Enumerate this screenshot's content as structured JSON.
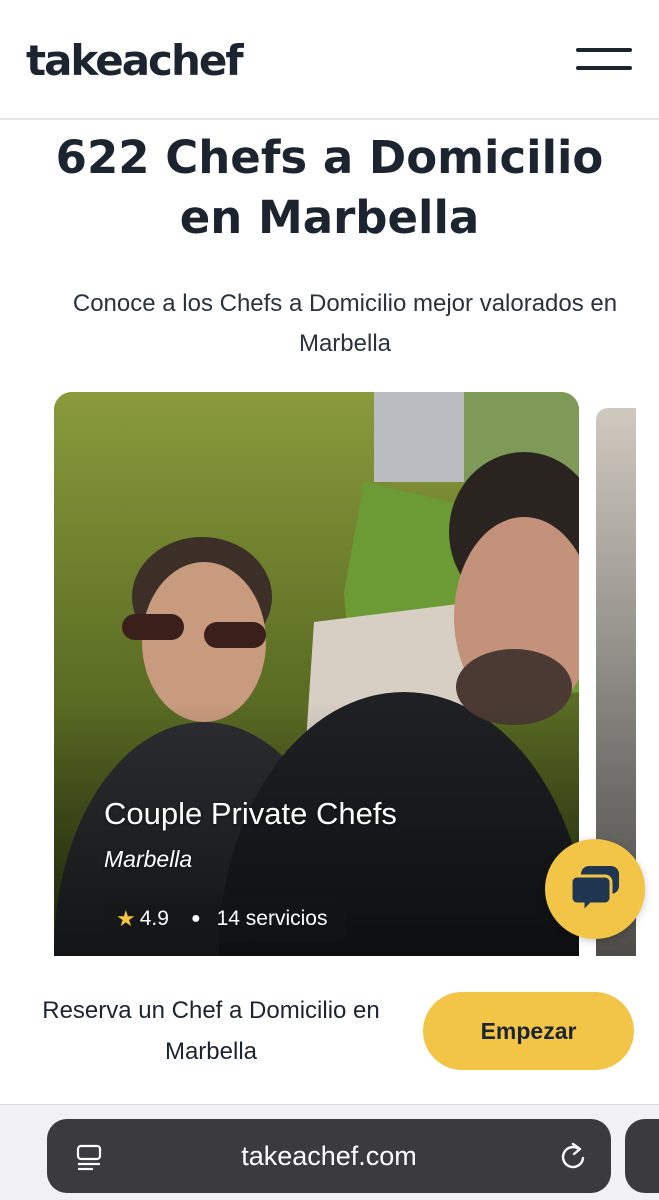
{
  "header": {
    "logo": "takeachef",
    "menu_icon": "hamburger-menu-icon"
  },
  "main": {
    "title": "622 Chefs a Domicilio en Marbella",
    "subtitle": "Conoce a los Chefs a Domicilio mejor valorados en Marbella"
  },
  "chef_card": {
    "name": "Couple Private Chefs",
    "city": "Marbella",
    "rating": "4.9",
    "services": "14 servicios",
    "star_color": "#f5c242"
  },
  "chat": {
    "icon": "chat-bubbles-icon"
  },
  "cta": {
    "text": "Reserva un Chef a Domicilio en Marbella",
    "button_label": "Empezar",
    "accent": "#f3c547"
  },
  "browser": {
    "url": "takeachef.com",
    "reader_icon": "reader-mode-icon",
    "reload_icon": "reload-icon"
  }
}
